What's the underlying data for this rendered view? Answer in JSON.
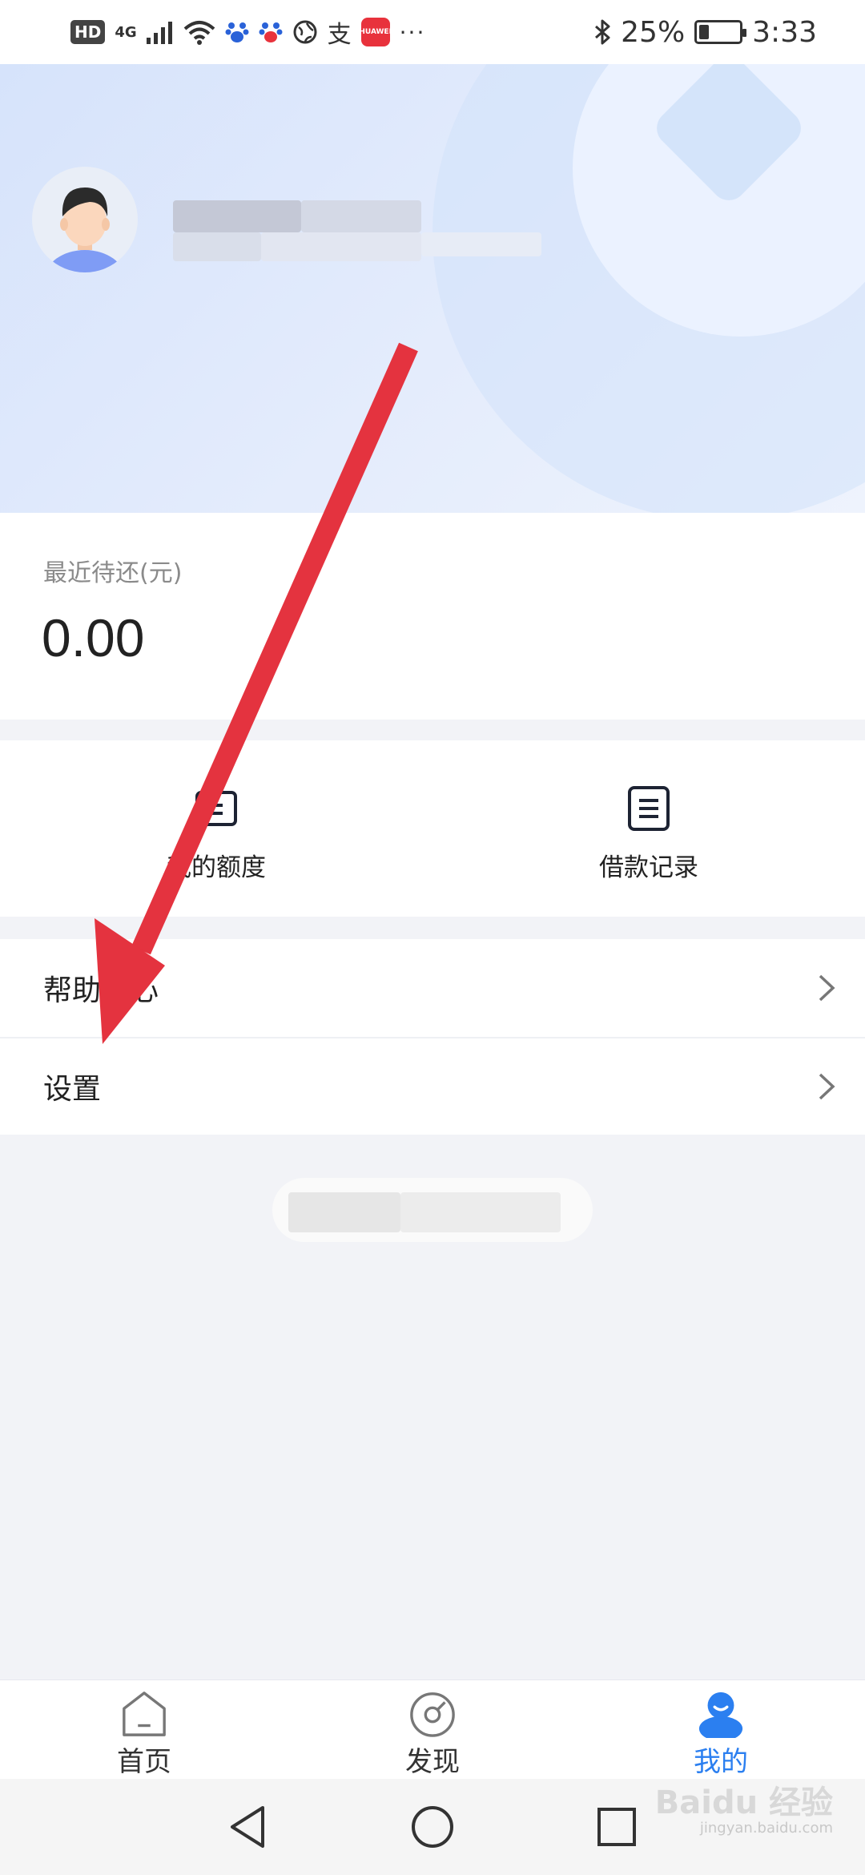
{
  "status_bar": {
    "hd": "HD",
    "network": "4G",
    "battery": "25%",
    "battery_level": 0.25,
    "time": "3:33",
    "huawei_badge": "HUAWEI",
    "more": "···",
    "alipay": "支"
  },
  "repay": {
    "label": "最近待还(元)",
    "amount": "0.00"
  },
  "quick_actions": [
    {
      "label": "我的额度",
      "icon": "wallet-icon"
    },
    {
      "label": "借款记录",
      "icon": "list-icon"
    }
  ],
  "menu": [
    {
      "label": "帮助中心",
      "icon": "chevron-right-icon"
    },
    {
      "label": "设置",
      "icon": "chevron-right-icon"
    }
  ],
  "bottom_nav": [
    {
      "label": "首页",
      "icon": "home-icon",
      "active": false
    },
    {
      "label": "发现",
      "icon": "discover-icon",
      "active": false
    },
    {
      "label": "我的",
      "icon": "profile-icon",
      "active": true
    }
  ],
  "colors": {
    "accent": "#2b7ff0",
    "arrow": "#e4333f",
    "header_bg": "#dce6fb"
  },
  "watermark": {
    "brand": "Baidu 经验",
    "url": "jingyan.baidu.com"
  }
}
